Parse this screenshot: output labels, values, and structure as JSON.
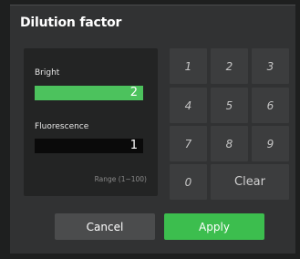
{
  "dialog": {
    "title": "Dilution factor"
  },
  "bright": {
    "label": "Bright",
    "value": "2"
  },
  "fluorescence": {
    "label": "Fluorescence",
    "value": "1"
  },
  "range_text": "Range (1~100)",
  "keypad": {
    "keys": [
      "1",
      "2",
      "3",
      "4",
      "5",
      "6",
      "7",
      "8",
      "9",
      "0"
    ],
    "clear_label": "Clear"
  },
  "buttons": {
    "cancel_label": "Cancel",
    "apply_label": "Apply"
  },
  "colors": {
    "accent_green": "#4cc25d",
    "apply_green": "#3cbe4e",
    "dialog_bg": "#313233",
    "panel_bg": "#232424",
    "key_bg": "#3c3d3e"
  }
}
